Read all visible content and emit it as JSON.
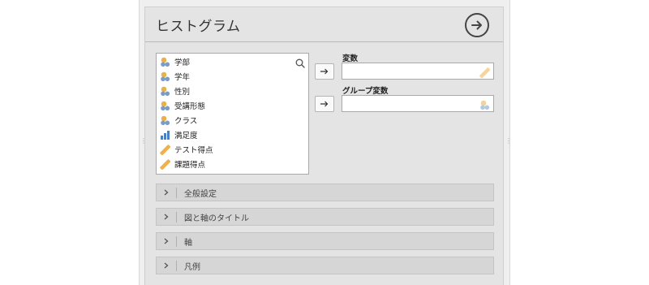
{
  "header": {
    "title": "ヒストグラム",
    "run_icon": "arrow-right-circle-icon"
  },
  "variables": [
    {
      "name": "学部",
      "icon": "nominal-variable-icon"
    },
    {
      "name": "学年",
      "icon": "nominal-variable-icon"
    },
    {
      "name": "性別",
      "icon": "nominal-variable-icon"
    },
    {
      "name": "受講形態",
      "icon": "nominal-variable-icon"
    },
    {
      "name": "クラス",
      "icon": "nominal-variable-icon"
    },
    {
      "name": "満足度",
      "icon": "ordinal-variable-icon"
    },
    {
      "name": "テスト得点",
      "icon": "continuous-variable-icon"
    },
    {
      "name": "課題得点",
      "icon": "continuous-variable-icon"
    }
  ],
  "targets": {
    "variable": {
      "label": "変数",
      "value": "",
      "hint_icon": "continuous-variable-icon"
    },
    "group": {
      "label": "グループ変数",
      "value": "",
      "hint_icon": "nominal-variable-icon"
    }
  },
  "sections": [
    {
      "label": "全般設定"
    },
    {
      "label": "図と軸のタイトル"
    },
    {
      "label": "軸"
    },
    {
      "label": "凡例"
    }
  ],
  "colors": {
    "nominal_icon_gold": "#e7b24a",
    "nominal_icon_blue": "#7a9cc8",
    "ordinal_icon_blue": "#4a7fc1",
    "continuous_icon": "#f0b04a"
  }
}
